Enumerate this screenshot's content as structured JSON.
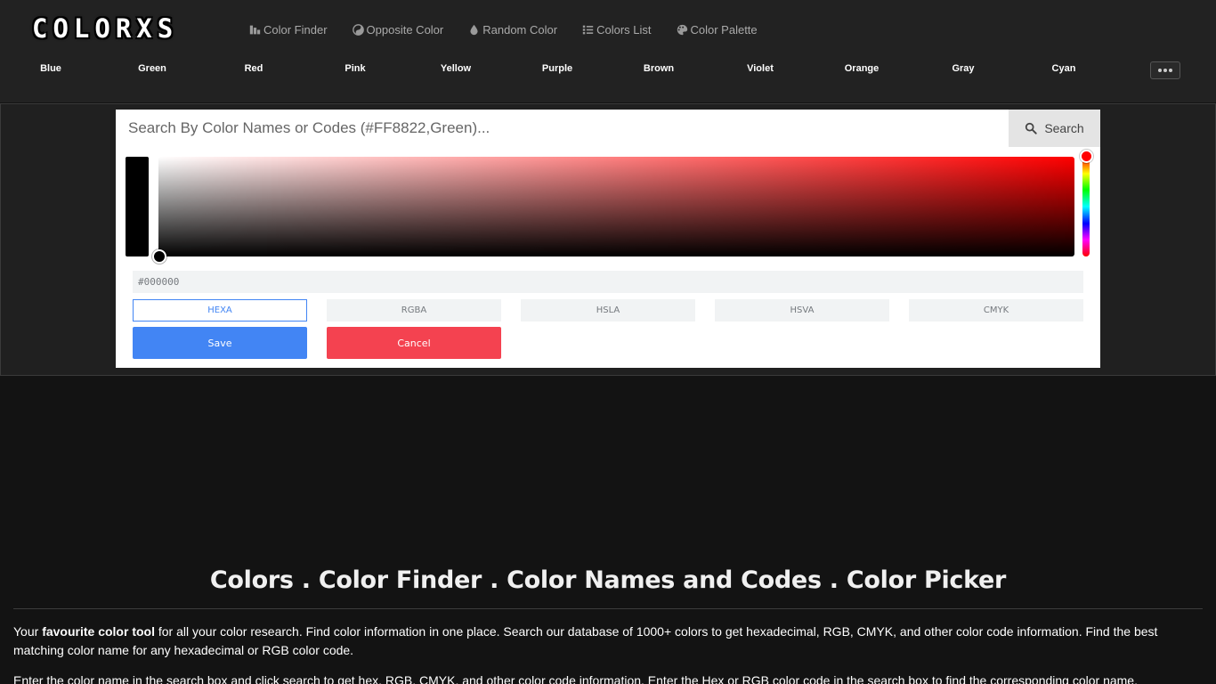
{
  "brand": {
    "logo": "COLORXS"
  },
  "topnav": [
    {
      "label": "Color Finder",
      "icon": "color-finder-icon"
    },
    {
      "label": "Opposite Color",
      "icon": "yin-yang-icon"
    },
    {
      "label": "Random Color",
      "icon": "droplet-icon"
    },
    {
      "label": "Colors List",
      "icon": "list-icon"
    },
    {
      "label": "Color Palette",
      "icon": "palette-icon"
    }
  ],
  "categories": [
    "Blue",
    "Green",
    "Red",
    "Pink",
    "Yellow",
    "Purple",
    "Brown",
    "Violet",
    "Orange",
    "Gray",
    "Cyan"
  ],
  "search": {
    "placeholder": "Search By Color Names or Codes (#FF8822,Green)...",
    "button_label": "Search"
  },
  "picker": {
    "result_value": "#000000",
    "hue_color": "#ff0000",
    "formats": [
      "HEXA",
      "RGBA",
      "HSLA",
      "HSVA",
      "CMYK"
    ],
    "active_format": "HEXA",
    "save_label": "Save",
    "cancel_label": "Cancel"
  },
  "content": {
    "title": "Colors . Color Finder . Color Names and Codes . Color Picker",
    "para1_prefix": "Your ",
    "para1_bold": "favourite color tool",
    "para1_suffix": " for all your color research. Find color information in one place. Search our database of 1000+ colors to get hexadecimal, RGB, CMYK, and other color code information. Find the best matching color name for any hexadecimal or RGB color code.",
    "para2": "Enter the color name in the search box and click search to get hex, RGB, CMYK, and other color code information. Enter the Hex or RGB color code in the search box to find the corresponding color name."
  },
  "colors": {
    "save": "#4285f4",
    "cancel": "#f44250",
    "header_bg": "#222222",
    "page_bg": "#131313"
  }
}
